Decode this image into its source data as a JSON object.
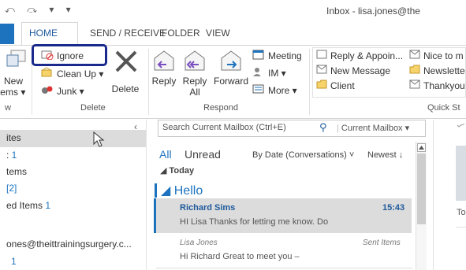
{
  "window": {
    "quick_access": "⤺ ⤼ ▾ ▾",
    "title": "Inbox - lisa.jones@the"
  },
  "tabs": [
    {
      "label": "HOME"
    },
    {
      "label": "SEND / RECEIVE"
    },
    {
      "label": "FOLDER"
    },
    {
      "label": "VIEW"
    }
  ],
  "ribbon": {
    "new_items": {
      "line1": "New",
      "line2": "Items ▾"
    },
    "delete_group": {
      "ignore": "Ignore",
      "clean_up": "Clean Up ▾",
      "junk": "Junk ▾",
      "delete": "Delete",
      "label": "Delete"
    },
    "respond_group": {
      "reply": "Reply",
      "reply_all_line1": "Reply",
      "reply_all_line2": "All",
      "forward": "Forward",
      "meeting": "Meeting",
      "im": "IM ▾",
      "more": "More ▾",
      "label": "Respond"
    },
    "quick_steps": {
      "reply_appoint": "Reply & Appoin...",
      "new_message": "New Message",
      "client": "Client",
      "nice_to_meet": "Nice to m",
      "newsletter": "Newslette",
      "thankyou": "Thankyou",
      "label": "Quick St"
    },
    "new_label_fragment": "w"
  },
  "nav": {
    "items": [
      {
        "label": "ites",
        "count": ""
      },
      {
        "label": ": ",
        "count": "1"
      },
      {
        "label": "tems",
        "count": ""
      },
      {
        "label": "",
        "count": "[2]"
      },
      {
        "label": "ed Items ",
        "count": "1"
      }
    ],
    "account": "ones@theittrainingsurgery.c...",
    "account_count": "1"
  },
  "list": {
    "search_placeholder": "Search Current Mailbox (Ctrl+E)",
    "search_scope": "Current Mailbox",
    "filter_all": "All",
    "filter_unread": "Unread",
    "sort_by": "By Date (Conversations) ˅",
    "sort_order": "Newest ↓",
    "group_today": "◢ Today",
    "conversation_title": "◢ Hello",
    "messages": [
      {
        "sender": "Richard Sims",
        "time": "15:43",
        "preview": "HI Lisa  Thanks for letting me know. Do"
      },
      {
        "sender": "Lisa Jones",
        "folder": "Sent Items",
        "preview": "Hi Richard  Great to meet you –"
      }
    ]
  },
  "reading": {
    "to_fragment": "To"
  },
  "colors": {
    "accent": "#1e73be",
    "highlight_box": "#1a2a8c",
    "selected_bg": "#dcdcdc"
  }
}
